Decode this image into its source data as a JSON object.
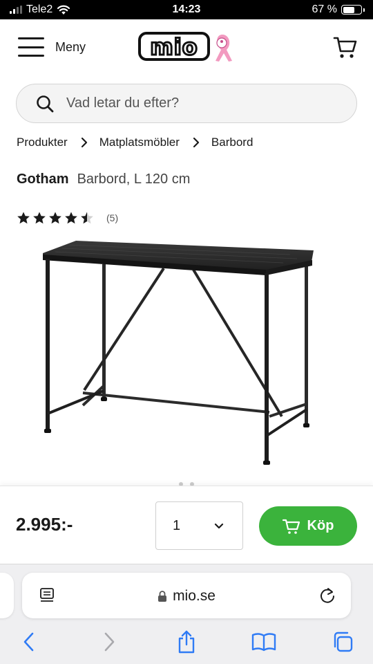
{
  "status_bar": {
    "carrier": "Tele2",
    "time": "14:23",
    "battery_text": "67 %",
    "battery_level": 0.67
  },
  "header": {
    "menu_label": "Meny",
    "logo_text": "mio",
    "cart_icon": "cart-icon"
  },
  "search": {
    "placeholder": "Vad letar du efter?",
    "icon": "search-icon"
  },
  "breadcrumb": [
    "Produkter",
    "Matplatsmöbler",
    "Barbord"
  ],
  "product": {
    "brand": "Gotham",
    "description": "Barbord, L 120 cm",
    "rating": 4.5,
    "rating_max": 5,
    "rating_count": "(5)"
  },
  "buy_bar": {
    "price": "2.995:-",
    "quantity": "1",
    "buy_label": "Köp",
    "buy_color": "#3bb33c"
  },
  "browser": {
    "url": "mio.se",
    "icons": [
      "reader-icon",
      "lock-icon",
      "reload-icon",
      "back-icon",
      "forward-icon",
      "share-icon",
      "bookmarks-icon",
      "tabs-icon"
    ]
  }
}
